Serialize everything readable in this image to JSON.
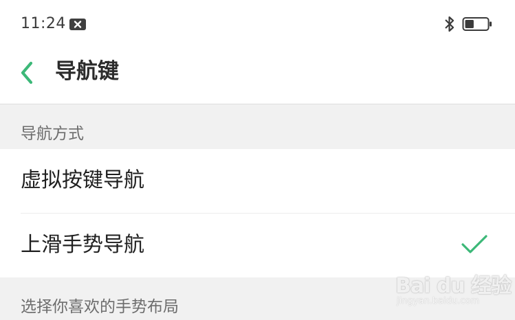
{
  "status_bar": {
    "time": "11:24",
    "notification_icon": "close-box-icon",
    "bluetooth_icon": "bluetooth-icon",
    "battery_icon": "battery-icon",
    "battery_level": 0.4
  },
  "nav": {
    "back_icon": "chevron-left-icon",
    "title": "导航键"
  },
  "sections": {
    "nav_mode_header": "导航方式",
    "gesture_layout_header": "选择你喜欢的手势布局"
  },
  "options": [
    {
      "label": "虚拟按键导航",
      "selected": false
    },
    {
      "label": "上滑手势导航",
      "selected": true
    }
  ],
  "watermark": {
    "brand": "Bai du 经验",
    "url": "jingyan.baidu.com"
  },
  "colors": {
    "accent": "#3cb878",
    "background": "#f1f1f1",
    "surface": "#ffffff",
    "text_primary": "#1f1f1f",
    "text_secondary": "#6d6d6d"
  }
}
